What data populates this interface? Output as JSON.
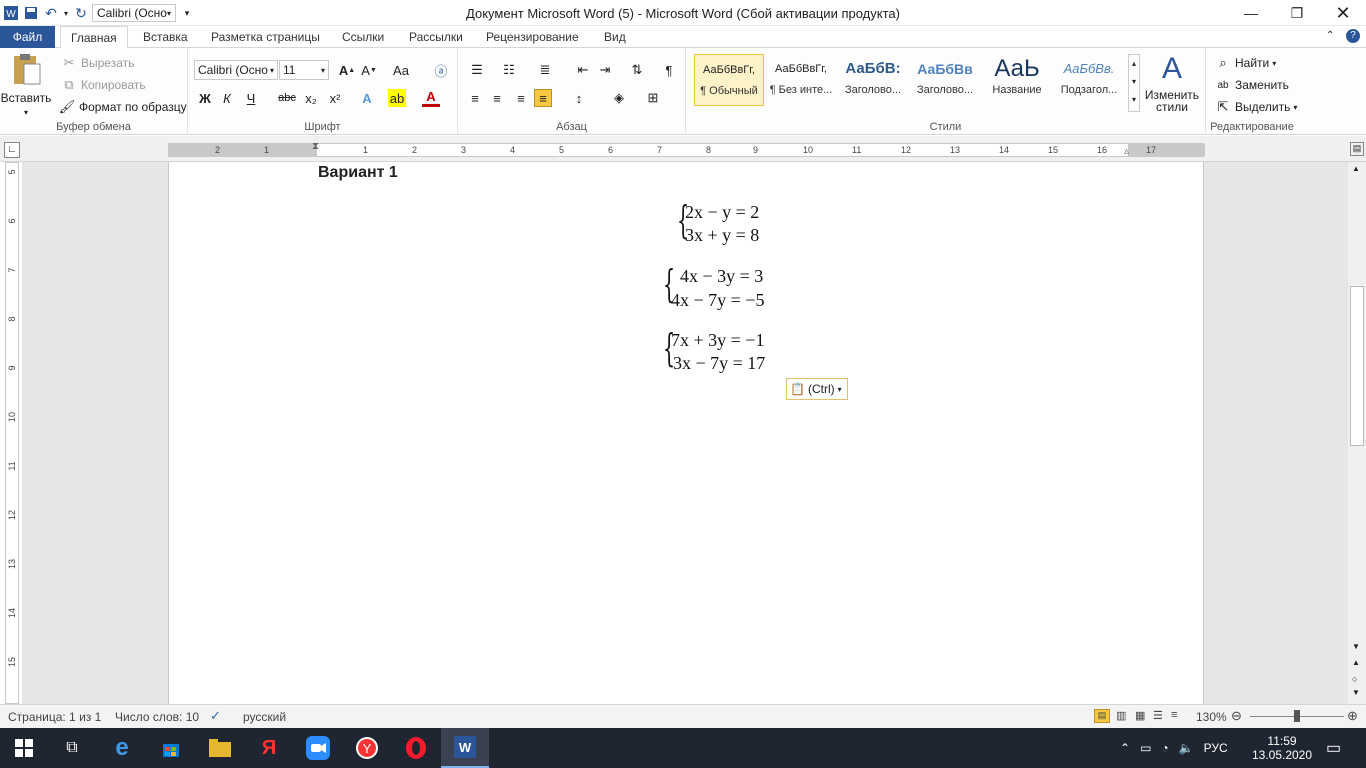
{
  "titlebar": {
    "title": "Документ Microsoft Word (5)  -  Microsoft Word (Сбой активации продукта)",
    "qat_font": "Calibri (Осно"
  },
  "tabs": [
    "Файл",
    "Главная",
    "Вставка",
    "Разметка страницы",
    "Ссылки",
    "Рассылки",
    "Рецензирование",
    "Вид"
  ],
  "ribbon": {
    "clipboard": {
      "label": "Буфер обмена",
      "paste": "Вставить",
      "cut": "Вырезать",
      "copy": "Копировать",
      "format_painter": "Формат по образцу"
    },
    "font": {
      "label": "Шрифт",
      "name": "Calibri (Осно",
      "size": "11"
    },
    "paragraph": {
      "label": "Абзац"
    },
    "styles": {
      "label": "Стили",
      "items": [
        {
          "sample": "АаБбВвГг,",
          "name": "¶ Обычный"
        },
        {
          "sample": "АаБбВвГг,",
          "name": "¶ Без инте..."
        },
        {
          "sample": "АаБбВ:",
          "name": "Заголово..."
        },
        {
          "sample": "АаБбВв",
          "name": "Заголово..."
        },
        {
          "sample": "АаЬ",
          "name": "Название"
        },
        {
          "sample": "АаБбВв.",
          "name": "Подзагол..."
        }
      ],
      "change": "Изменить стили"
    },
    "editing": {
      "label": "Редактирование",
      "find": "Найти",
      "replace": "Заменить",
      "select": "Выделить"
    }
  },
  "ruler": {
    "h": [
      "2",
      "1",
      "1",
      "2",
      "3",
      "4",
      "5",
      "6",
      "7",
      "8",
      "9",
      "10",
      "11",
      "12",
      "13",
      "14",
      "15",
      "16",
      "17"
    ],
    "v": [
      "5",
      "6",
      "7",
      "8",
      "9",
      "10",
      "11",
      "12",
      "13",
      "14",
      "15"
    ]
  },
  "document": {
    "heading": "Вариант 1",
    "systems": [
      [
        "2x − y = 2",
        "3x + y = 8"
      ],
      [
        "4x − 3y = 3",
        "4x − 7y = −5"
      ],
      [
        "7x + 3y = −1",
        "3x − 7y = 17"
      ]
    ],
    "paste_options": "(Ctrl)"
  },
  "status": {
    "page": "Страница: 1 из 1",
    "words": "Число слов: 10",
    "lang": "русский",
    "zoom": "130%"
  },
  "taskbar": {
    "lang": "РУС",
    "time": "11:59",
    "date": "13.05.2020"
  }
}
